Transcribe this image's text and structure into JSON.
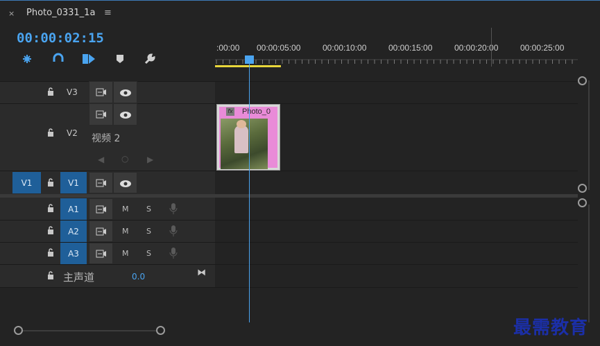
{
  "panel": {
    "close_glyph": "×",
    "sequence_name": "Photo_0331_1a",
    "menu_glyph": "≡",
    "timecode": "00:00:02:15"
  },
  "tools": [
    {
      "name": "snap-icon"
    },
    {
      "name": "linked-selection-icon"
    },
    {
      "name": "add-marker-icon"
    },
    {
      "name": "marker-icon"
    },
    {
      "name": "wrench-icon"
    }
  ],
  "ruler": {
    "labels": [
      ":00:00",
      "00:00:05:00",
      "00:00:10:00",
      "00:00:15:00",
      "00:00:20:00",
      "00:00:25:00"
    ]
  },
  "tracks": {
    "v3": {
      "name": "V3"
    },
    "v2": {
      "name": "V2",
      "label": "视频 2"
    },
    "v1": {
      "source": "V1",
      "name": "V1"
    },
    "a1": {
      "name": "A1",
      "m": "M",
      "s": "S"
    },
    "a2": {
      "name": "A2",
      "m": "M",
      "s": "S"
    },
    "a3": {
      "name": "A3",
      "m": "M",
      "s": "S"
    },
    "master": {
      "name": "主声道",
      "value": "0.0"
    }
  },
  "clip": {
    "fx": "fx",
    "name": "Photo_0"
  },
  "watermark": "最需教育",
  "colors": {
    "accent": "#4aa4f0",
    "track_target": "#1f5f99",
    "clip": "#e98bd8",
    "work_area": "#e8d63a"
  }
}
